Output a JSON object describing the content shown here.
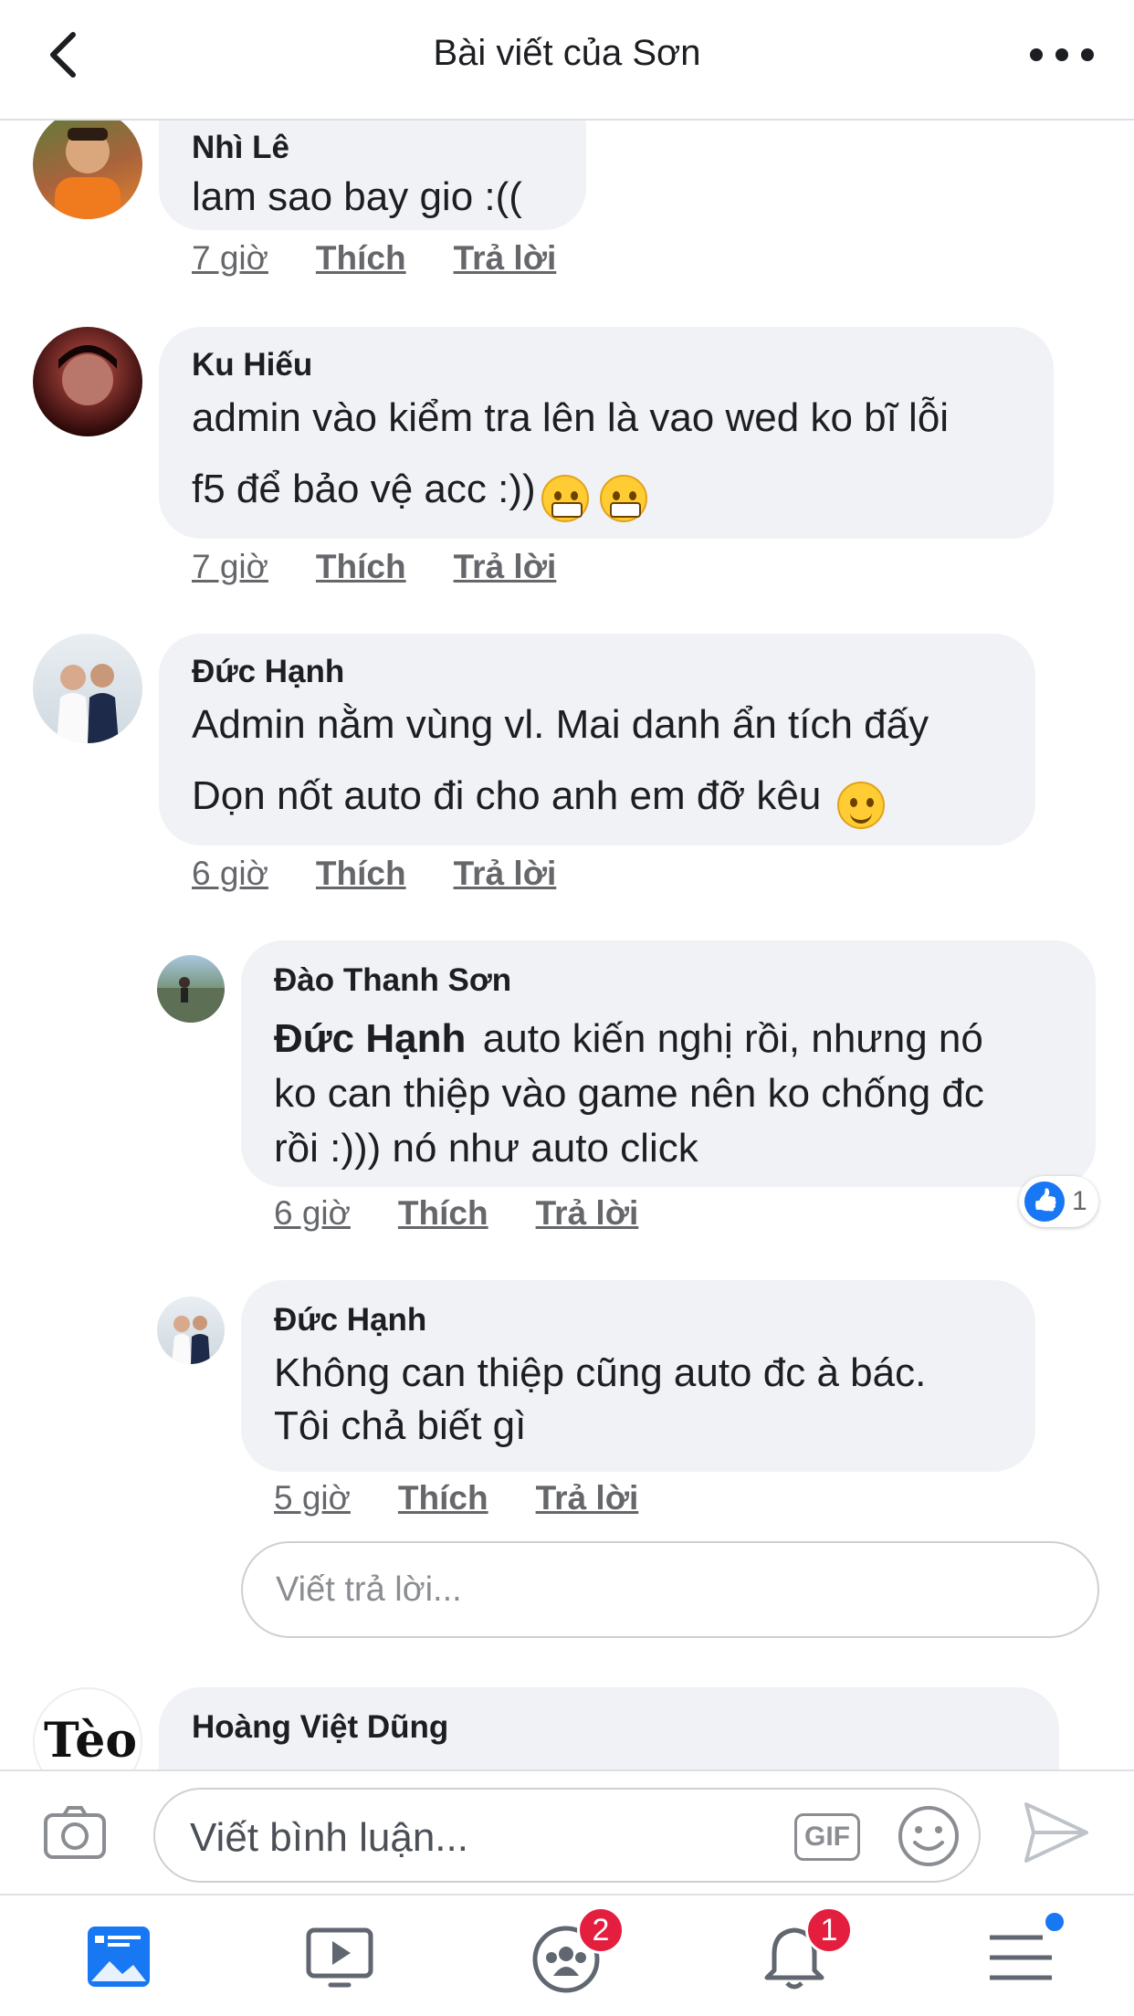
{
  "header": {
    "title": "Bài viết của Sơn"
  },
  "comments": [
    {
      "name": "Nhì Lê",
      "text": [
        "lam sao bay gio :(("
      ],
      "time": "7 giờ",
      "like": "Thích",
      "reply": "Trả lời"
    },
    {
      "name": "Ku Hiếu",
      "text": [
        "admin vào kiểm tra lên là vao wed ko bĩ lỗi",
        "f5 để bảo vệ acc :))"
      ],
      "time": "7 giờ",
      "like": "Thích",
      "reply": "Trả lời"
    },
    {
      "name": "Đức Hạnh",
      "text": [
        "Admin nằm vùng vl. Mai danh ẩn tích đấy",
        "Dọn nốt auto đi cho anh em đỡ kêu"
      ],
      "time": "6 giờ",
      "like": "Thích",
      "reply": "Trả lời"
    },
    {
      "name": "Đào Thanh Sơn",
      "mention": "Đức Hạnh",
      "text": [
        "auto kiến nghị rồi, nhưng nó",
        "ko can thiệp vào game nên ko chống đc",
        "rồi :))) nó như auto click"
      ],
      "time": "6 giờ",
      "like": "Thích",
      "reply": "Trả lời",
      "like_count": "1"
    },
    {
      "name": "Đức Hạnh",
      "text": [
        "Không can thiệp cũng auto đc à bác.",
        "Tôi chả biết gì"
      ],
      "time": "5 giờ",
      "like": "Thích",
      "reply": "Trả lời"
    },
    {
      "name": "Hoàng Việt Dũng",
      "avatar_text": "Tèo"
    }
  ],
  "reply_input": {
    "placeholder": "Viết trả lời..."
  },
  "composer": {
    "placeholder": "Viết bình luận...",
    "gif": "GIF"
  },
  "tabs": {
    "groups_badge": "2",
    "notifications_badge": "1"
  },
  "colors": {
    "accent": "#1877f2",
    "badge": "#e41e3f",
    "bubble": "#f0f2f5"
  }
}
